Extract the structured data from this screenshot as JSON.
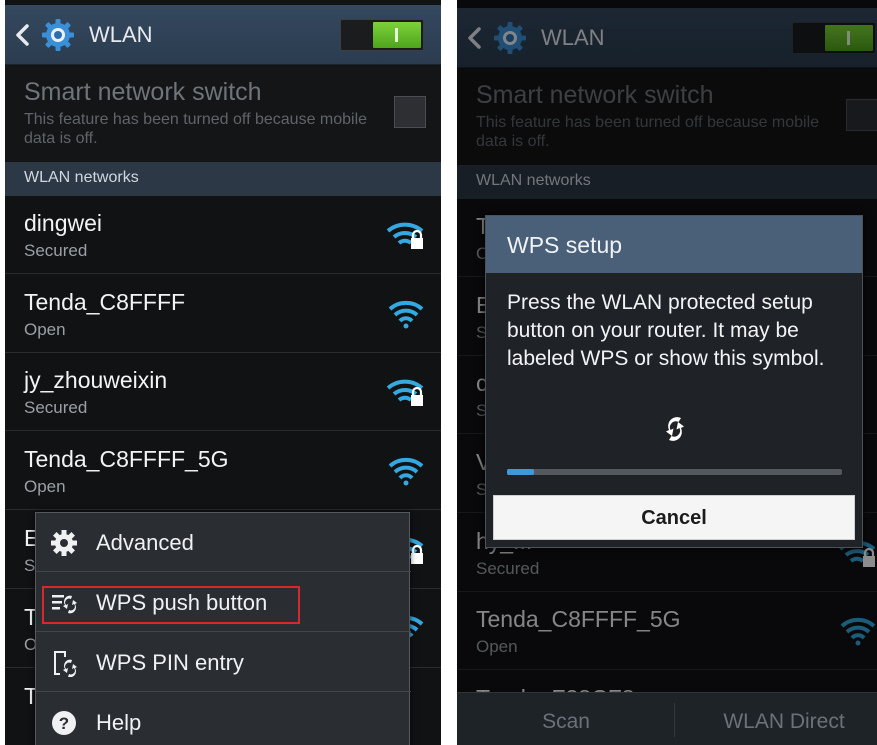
{
  "colors": {
    "accent_green": "#5cb82a",
    "header_blue": "#2b3c4f",
    "wifi_blue": "#34a8e0",
    "highlight_red": "#d9272e",
    "progress_blue": "#3f99d8"
  },
  "left": {
    "header": {
      "back_icon": "back-chevron-icon",
      "settings_icon": "gear-icon",
      "title": "WLAN",
      "toggle_on": true
    },
    "smart_switch": {
      "title": "Smart network switch",
      "description": "This feature has been turned off because mobile data is off."
    },
    "section_header": "WLAN networks",
    "networks": [
      {
        "name": "dingwei",
        "status": "Secured",
        "icon": "wifi-secured-icon"
      },
      {
        "name": "Tenda_C8FFFF",
        "status": "Open",
        "icon": "wifi-icon"
      },
      {
        "name": "jy_zhouweixin",
        "status": "Secured",
        "icon": "wifi-secured-icon"
      },
      {
        "name": "Tenda_C8FFFF_5G",
        "status": "Open",
        "icon": "wifi-icon"
      },
      {
        "name": "E",
        "status": "S",
        "icon": "wifi-secured-icon"
      },
      {
        "name": "T",
        "status": "O",
        "icon": "wifi-icon"
      },
      {
        "name": "T",
        "status": "",
        "icon": "wifi-icon"
      }
    ],
    "menu": {
      "items": [
        {
          "label": "Advanced",
          "icon": "gear-icon"
        },
        {
          "label": "WPS push button",
          "icon": "wps-push-icon",
          "highlighted": true
        },
        {
          "label": "WPS PIN entry",
          "icon": "wps-pin-icon"
        },
        {
          "label": "Help",
          "icon": "help-icon"
        }
      ]
    }
  },
  "right": {
    "header": {
      "title": "WLAN",
      "toggle_on": true
    },
    "smart_switch": {
      "title": "Smart network switch",
      "description": "This feature has been turned off because mobile data is off."
    },
    "section_header": "WLAN networks",
    "networks": [
      {
        "name": "T",
        "status": "O"
      },
      {
        "name": "E",
        "status": "S"
      },
      {
        "name": "c",
        "status": "S"
      },
      {
        "name": "V",
        "status": "S"
      },
      {
        "name": "hy_...",
        "status": "Secured"
      },
      {
        "name": "Tenda_C8FFFF_5G",
        "status": "Open"
      },
      {
        "name": "Tenda_F28CF8",
        "status": ""
      }
    ],
    "dialog": {
      "title": "WPS setup",
      "message": "Press the WLAN protected setup button on your router. It may be labeled WPS or show this symbol.",
      "symbol_icon": "wps-symbol-icon",
      "progress": 0.08,
      "cancel_label": "Cancel"
    },
    "bottom_bar": {
      "scan_label": "Scan",
      "direct_label": "WLAN Direct"
    }
  }
}
